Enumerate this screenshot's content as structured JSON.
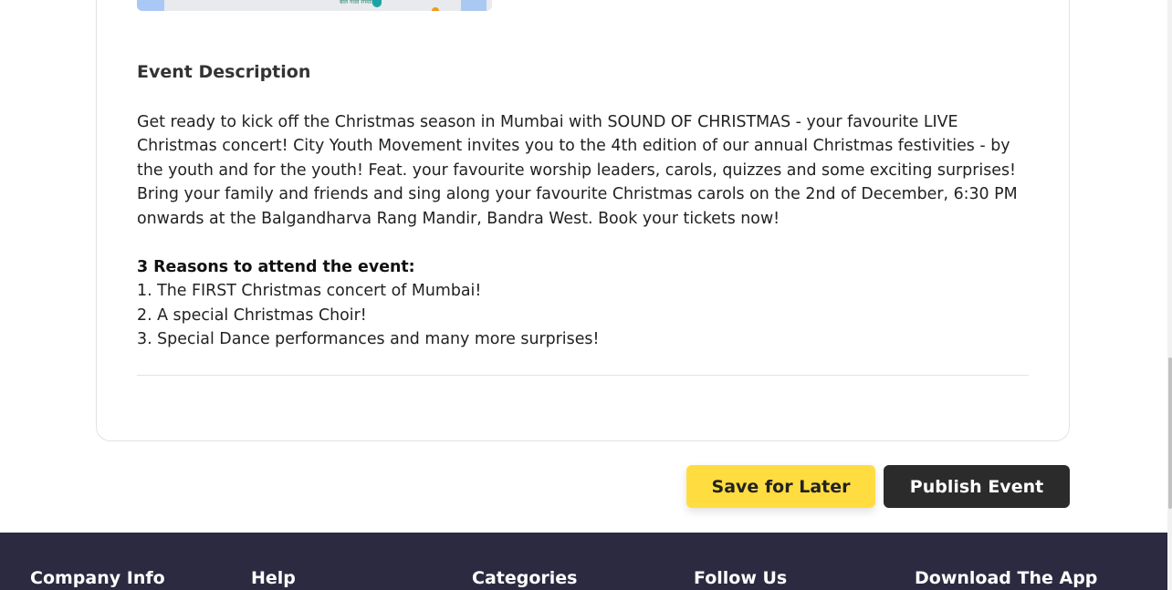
{
  "event": {
    "section_title": "Event Description",
    "description": "Get ready to kick off the Christmas season in Mumbai with SOUND OF CHRISTMAS - your favourite LIVE Christmas concert! City Youth Movement invites you to the 4th edition of our annual Christmas festivities - by the youth and for the youth! Feat. your favourite worship leaders, carols, quizzes and some exciting surprises! Bring your family and friends and sing along your favourite Christmas carols on the 2nd of December, 6:30 PM onwards at the Balgandharva Rang Mandir, Bandra West. Book your tickets now!",
    "reasons_heading": "3 Reasons to attend the event:",
    "reasons": [
      "1. The FIRST Christmas concert of Mumbai!",
      "2. A special Christmas Choir!",
      "3. Special Dance performances and many more surprises!"
    ]
  },
  "map": {
    "label": "बाल गंधर्व रंगमंदिर"
  },
  "actions": {
    "save_label": "Save for Later",
    "publish_label": "Publish Event"
  },
  "footer": {
    "columns": [
      "Company Info",
      "Help",
      "Categories",
      "Follow Us",
      "Download The App"
    ]
  },
  "colors": {
    "save_button": "#ffdd40",
    "publish_button": "#2b2b2b",
    "footer_bg": "#2b2a40"
  }
}
